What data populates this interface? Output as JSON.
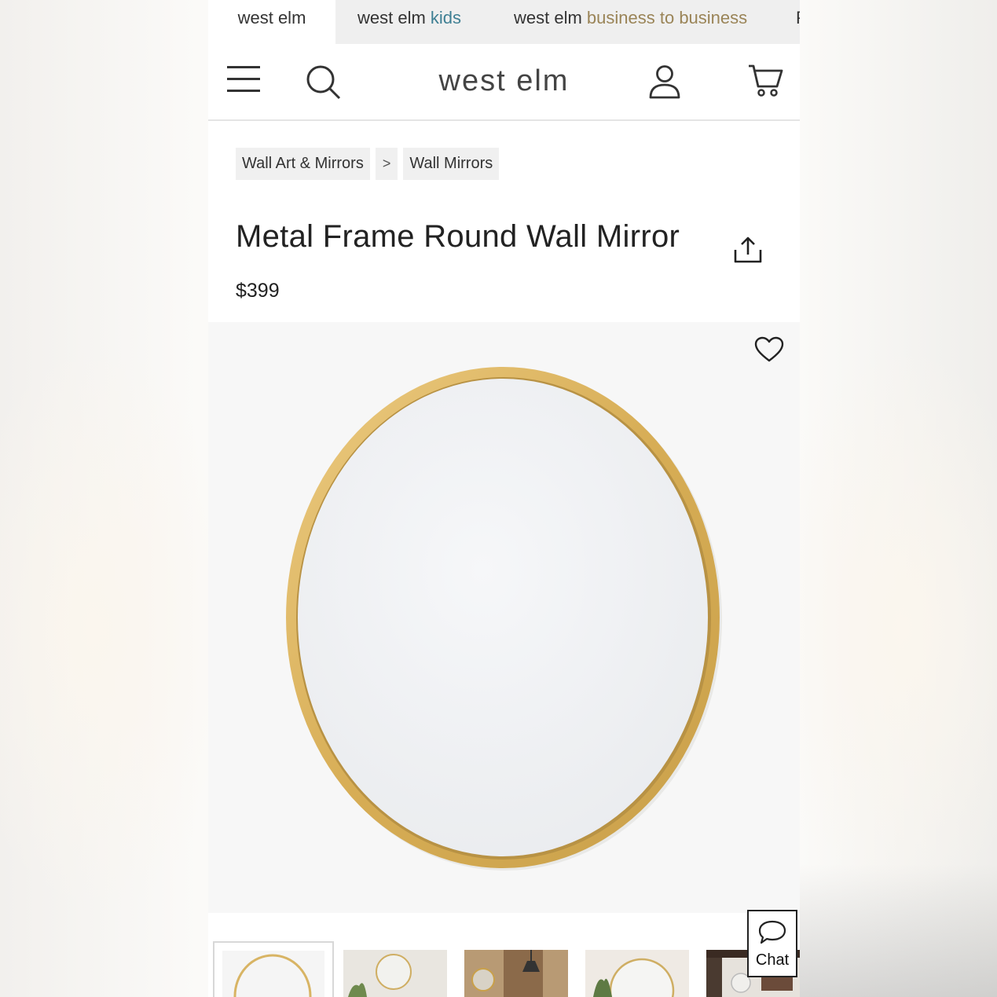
{
  "brand_tabs": [
    {
      "prefix": "west elm",
      "suffix": "",
      "active": true
    },
    {
      "prefix": "west elm",
      "suffix": "kids",
      "active": false
    },
    {
      "prefix": "west elm",
      "suffix": "business to business",
      "active": false
    },
    {
      "prefix": "P",
      "suffix": "",
      "active": false
    }
  ],
  "header": {
    "logo": "west elm",
    "icons": [
      "menu-icon",
      "search-icon",
      "account-icon",
      "cart-icon"
    ]
  },
  "breadcrumb": {
    "items": [
      "Wall Art & Mirrors",
      "Wall Mirrors"
    ],
    "separator": ">"
  },
  "product": {
    "title": "Metal Frame Round Wall Mirror",
    "price": "$399",
    "frame_color": "#d9b25c"
  },
  "chat": {
    "label": "Chat"
  },
  "thumbnails_count": 5
}
